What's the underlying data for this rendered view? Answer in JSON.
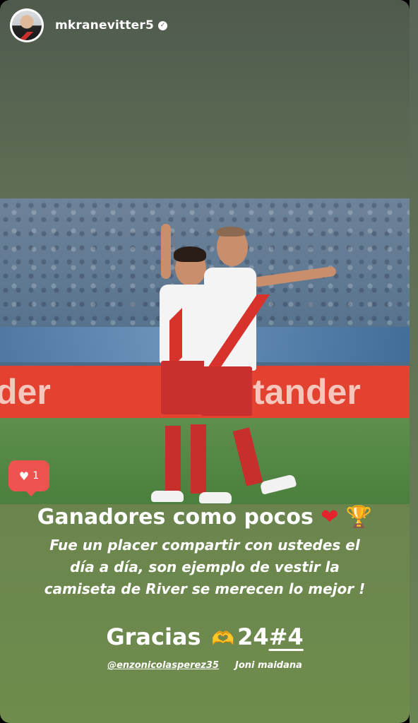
{
  "story": {
    "username": "mkranevitter5",
    "verified_icon": "verified-badge-icon",
    "avatar_icon": "profile-avatar"
  },
  "photo": {
    "ad_text_left": "der",
    "ad_text_right": "tander",
    "like_count": "1",
    "like_icon": "heart-icon",
    "like_color": "#ef5350"
  },
  "caption": {
    "title": "Ganadores como pocos",
    "title_emojis": [
      "red-heart",
      "trophy"
    ],
    "body_line1": "Fue un placer compartir con ustedes el",
    "body_line2": "día a día, son ejemplo de vestir la",
    "body_line3": "camiseta de River se merecen lo mejor !",
    "thanks_word": "Gracias",
    "thanks_emoji": "heart-hands",
    "thanks_number": "24",
    "thanks_hash": "#4",
    "mention_1": "@enzonicolasperez35",
    "mention_2": "Joni maidana"
  }
}
